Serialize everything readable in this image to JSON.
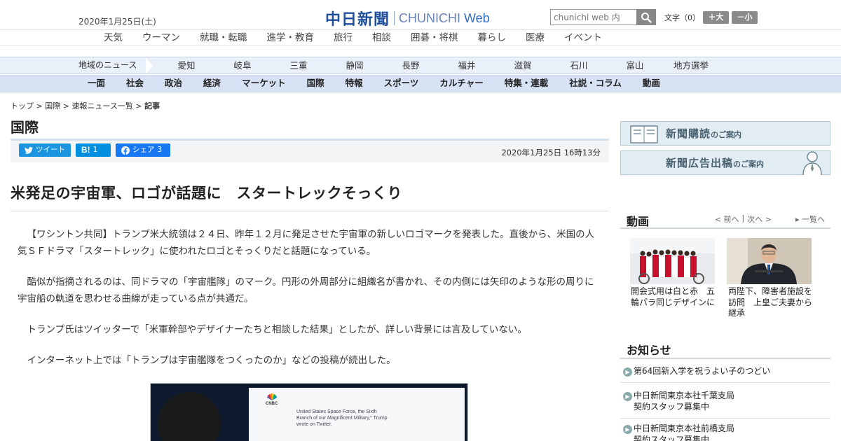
{
  "header": {
    "date": "2020年1月25日(土)",
    "logo_jp": "中日新聞",
    "logo_en_main": "CHUNICHI ",
    "logo_en_web": "Web",
    "search_placeholder": "chunichi web 内",
    "fontsize_label": "文字（0）",
    "fontsize_up": "＋大",
    "fontsize_down": "－小"
  },
  "top_nav": [
    "天気",
    "ウーマン",
    "就職・転職",
    "進学・教育",
    "旅行",
    "相談",
    "囲碁・将棋",
    "暮らし",
    "医療",
    "イベント"
  ],
  "region_nav": {
    "label": "地域のニュース",
    "items": [
      "愛知",
      "岐阜",
      "三重",
      "静岡",
      "長野",
      "福井",
      "滋賀",
      "石川",
      "富山",
      "地方選挙"
    ]
  },
  "category_nav": [
    "一面",
    "社会",
    "政治",
    "経済",
    "マーケット",
    "国際",
    "特報",
    "スポーツ",
    "カルチャー",
    "特集・連載",
    "社説・コラム",
    "動画"
  ],
  "breadcrumb": {
    "items": [
      "トップ",
      "国際",
      "速報ニュース一覧"
    ],
    "current": "記事",
    "sep": " > "
  },
  "section_title": "国際",
  "share": {
    "tweet": "ツイート",
    "hatena_label": "B!",
    "hatena_count": "1",
    "facebook": "シェア",
    "facebook_count": "3"
  },
  "published": "2020年1月25日 16時13分",
  "article": {
    "headline": "米発足の宇宙軍、ロゴが話題に　スタートレックそっくり",
    "paragraphs": [
      "【ワシントン共同】トランプ米大統領は２４日、昨年１２月に発足させた宇宙軍の新しいロゴマークを発表した。直後から、米国の人気ＳＦドラマ「スタートレック」に使われたロゴとそっくりだと話題になっている。",
      "酷似が指摘されるのは、同ドラマの「宇宙艦隊」のマーク。円形の外周部分に組織名が書かれ、その内側には矢印のような形の周りに宇宙船の軌道を思わせる曲線が走っている点が共通だ。",
      "トランプ氏はツイッターで「米軍幹部やデザイナーたちと相談した結果」としたが、詳しい背景には言及していない。",
      "インターネット上では「トランプは宇宙艦隊をつくったのか」などの投稿が続出した。"
    ],
    "photo_screen_text": "United States Space Force, the Sixth Branch of our Magnificent Military,\" Trump wrote on Twitter.",
    "photo_brand": "CNBC"
  },
  "sidebar": {
    "banner1_main": "新聞購読",
    "banner1_sub": "のご案内",
    "banner2_main": "新聞広告出稿",
    "banner2_sub": "のご案内",
    "video": {
      "title": "動画",
      "prev": "前へ",
      "next": "次へ",
      "list": "一覧へ",
      "items": [
        {
          "caption": "開会式用は白と赤　五輪パラ同じデザインに"
        },
        {
          "caption": "両陛下、障害者施設を訪問　上皇ご夫妻から継承"
        }
      ]
    },
    "news": {
      "title": "お知らせ",
      "items": [
        "第64回新入学を祝うよい子のつどい",
        "中日新聞東京本社千葉支局\n契約スタッフ募集中",
        "中日新聞東京本社前橋支局\n契約スタッフ募集中"
      ]
    }
  },
  "colors": {
    "brand_blue": "#1f4f9c",
    "twitter": "#1b95e0",
    "hatena": "#008fde",
    "facebook": "#1877f2"
  }
}
